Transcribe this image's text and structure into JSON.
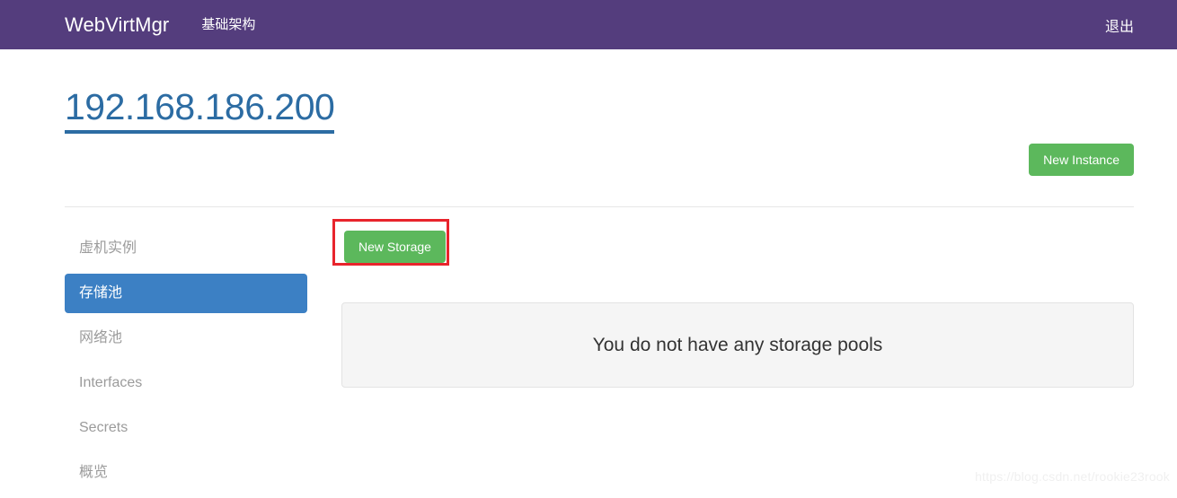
{
  "navbar": {
    "brand": "WebVirtMgr",
    "nav_link": "基础架构",
    "logout": "退出",
    "background_color": "#543d7d"
  },
  "header": {
    "title": "192.168.186.200",
    "title_color": "#2c6ca3",
    "new_instance_label": "New Instance",
    "new_instance_color": "#5cb85c"
  },
  "sidebar": {
    "items": [
      {
        "label": "虚机实例",
        "active": false
      },
      {
        "label": "存储池",
        "active": true
      },
      {
        "label": "网络池",
        "active": false
      },
      {
        "label": "Interfaces",
        "active": false
      },
      {
        "label": "Secrets",
        "active": false
      },
      {
        "label": "概览",
        "active": false
      }
    ],
    "active_color": "#3c80c4"
  },
  "content": {
    "new_storage_label": "New Storage",
    "new_storage_color": "#5cb85c",
    "highlight_color": "#e8242c",
    "empty_message": "You do not have any storage pools",
    "panel_background": "#f5f5f5"
  },
  "watermark": {
    "text": "https://blog.csdn.net/rookie23rook"
  }
}
